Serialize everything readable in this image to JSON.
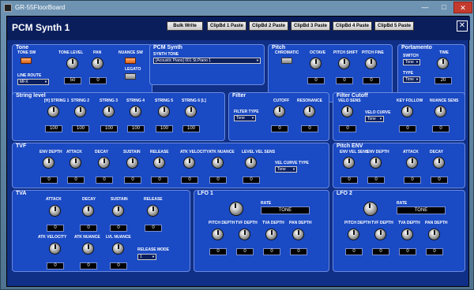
{
  "window": {
    "title": "GR-55FloorBoard",
    "min": "—",
    "max": "□",
    "close": "✕"
  },
  "header": {
    "title": "PCM Synth 1",
    "buttons": [
      "Bulk Write",
      "ClipBd 1 Paste",
      "ClipBd 2 Paste",
      "ClipBd 3 Paste",
      "ClipBd 4 Paste",
      "ClipBd 5 Paste"
    ],
    "close": "✕"
  },
  "tone": {
    "title": "Tone",
    "tone_sw": "TONE SW",
    "tone_level": "TONE LEVEL",
    "tone_level_val": "50",
    "pan": "PAN",
    "pan_val": "0",
    "nuance_sw": "NUANCE SW",
    "legato": "LEGATO",
    "line_route": "LINE ROUTE",
    "line_route_val": "MFX"
  },
  "pcm": {
    "title": "PCM Synth",
    "synth_tone": "SYNTH TONE",
    "synth_tone_val": "[Acoustic Piano]  001  St.Piano 1"
  },
  "pitch": {
    "title": "Pitch",
    "chromatic": "CHROMATIC",
    "octave": "OCTAVE",
    "octave_val": "0",
    "shift": "PITCH SHIFT",
    "shift_val": "0",
    "fine": "PITCH FINE",
    "fine_val": "0"
  },
  "porta": {
    "title": "Portamento",
    "switch": "SWITCH",
    "switch_val": "Tone",
    "type": "TYPE",
    "type_val": "Time",
    "time": "TIME",
    "time_val": "20"
  },
  "string": {
    "title": "String level",
    "labels": [
      "[H] STRING 1",
      "STRING 2",
      "STRING 3",
      "STRING 4",
      "STRING 5",
      "STRING 6 [L]"
    ],
    "values": [
      "100",
      "100",
      "100",
      "100",
      "100",
      "100"
    ]
  },
  "filter": {
    "title": "Filter",
    "cutoff": "CUTOFF",
    "cutoff_val": "0",
    "resonance": "RESONANCE",
    "resonance_val": "0",
    "type": "FILTER TYPE",
    "type_val": "Tone"
  },
  "fcut": {
    "title": "Filter Cutoff",
    "velo_sens": "VELO SENS",
    "velo_sens_val": "0",
    "velo_curve": "VELO CURVE",
    "velo_curve_val": "Tone",
    "key_follow": "KEY FOLLOW",
    "key_follow_val": "0",
    "nuance_sens": "NUANCE SENS",
    "nuance_sens_val": "0"
  },
  "tvf": {
    "title": "TVF",
    "labels": [
      "ENV DEPTH",
      "ATTACK",
      "DECAY",
      "SUSTAIN",
      "RELEASE",
      "ATK VELOCITY",
      "ATK NUANCE",
      "LEVEL VEL SENS"
    ],
    "values": [
      "0",
      "0",
      "0",
      "0",
      "0",
      "0",
      "0",
      "0"
    ],
    "vel_curve": "VEL CURVE TYPE",
    "vel_curve_val": "Tone"
  },
  "penv": {
    "title": "Pitch ENV",
    "labels": [
      "ENV VEL SENS",
      "ENV DEPTH",
      "ATTACK",
      "DECAY"
    ],
    "values": [
      "0",
      "0",
      "0",
      "0"
    ]
  },
  "tva": {
    "title": "TVA",
    "attack": "ATTACK",
    "decay": "DECAY",
    "sustain": "SUSTAIN",
    "release": "RELEASE",
    "atk_velocity": "ATK VELOCITY",
    "atk_nuance": "ATK NUANCE",
    "lvl_nuance": "LVL NUANCE",
    "values": [
      "0",
      "0",
      "0",
      "0",
      "0",
      "0",
      "0"
    ],
    "release_mode": "RELEASE MODE",
    "release_mode_val": "1"
  },
  "lfo1": {
    "title": "LFO 1",
    "rate": "RATE",
    "rate_val": "TONE",
    "labels": [
      "PITCH DEPTH",
      "TVF DEPTH",
      "TVA DEPTH",
      "PAN DEPTH"
    ],
    "values": [
      "0",
      "0",
      "0",
      "0"
    ]
  },
  "lfo2": {
    "title": "LFO 2",
    "rate": "RATE",
    "rate_val": "TONE",
    "labels": [
      "PITCH DEPTH",
      "TVF DEPTH",
      "TVA DEPTH",
      "PAN DEPTH"
    ],
    "values": [
      "0",
      "0",
      "0",
      "0"
    ]
  }
}
